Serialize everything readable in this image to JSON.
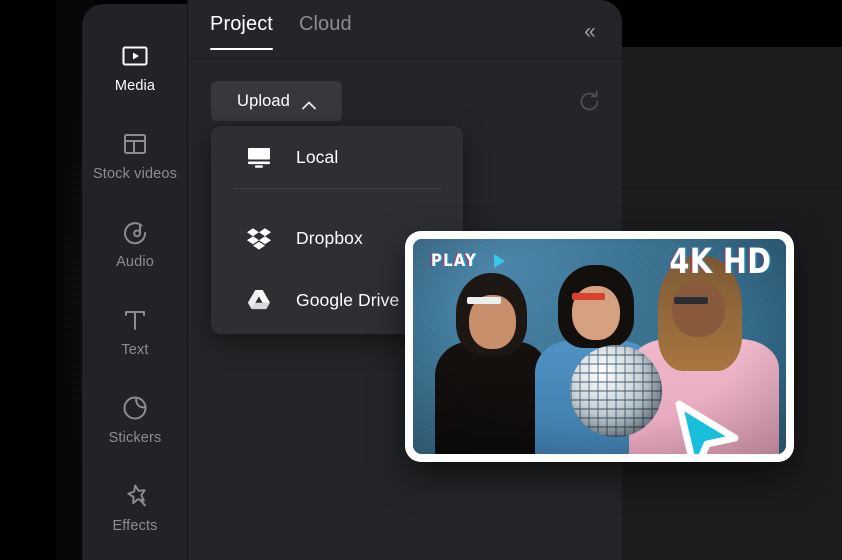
{
  "app": {
    "window_title": "Video editor media panel"
  },
  "sidebar": {
    "items": [
      {
        "label": "Media",
        "icon": "media-play-rectangle-icon",
        "active": true
      },
      {
        "label": "Stock videos",
        "icon": "layout-grid-icon",
        "active": false
      },
      {
        "label": "Audio",
        "icon": "music-note-circle-icon",
        "active": false
      },
      {
        "label": "Text",
        "icon": "text-t-icon",
        "active": false
      },
      {
        "label": "Stickers",
        "icon": "sticker-peel-circle-icon",
        "active": false
      },
      {
        "label": "Effects",
        "icon": "magic-star-icon",
        "active": false
      }
    ]
  },
  "panel": {
    "tabs": [
      {
        "label": "Project",
        "active": true
      },
      {
        "label": "Cloud",
        "active": false
      }
    ],
    "collapse_icon": "«",
    "collapse_icon_name": "collapse-panel-icon",
    "upload": {
      "label": "Upload",
      "chevron": "chevron-up-icon",
      "expanded": true
    },
    "refresh_icon_name": "refresh-icon"
  },
  "upload_menu": {
    "items": [
      {
        "label": "Local",
        "icon": "monitor-icon"
      },
      {
        "label": "Dropbox",
        "icon": "dropbox-icon"
      },
      {
        "label": "Google Drive",
        "icon": "google-drive-icon"
      }
    ]
  },
  "video_card": {
    "play_label": "PLAY",
    "play_icon": "play-triangle-icon",
    "quality_badge": "4K HD",
    "cursor_icon": "cursor-arrow-icon"
  },
  "colors": {
    "app_background": "#000000",
    "sidebar_background": "#222326",
    "panel_background": "#242528",
    "editor_background": "#1c1c1e",
    "menu_background": "#2e2f33",
    "upload_button": "#37383c",
    "text_primary": "#ffffff",
    "text_muted": "#8b8d91",
    "accent_cyan": "#17bfdd",
    "card_border": "#ffffff"
  }
}
